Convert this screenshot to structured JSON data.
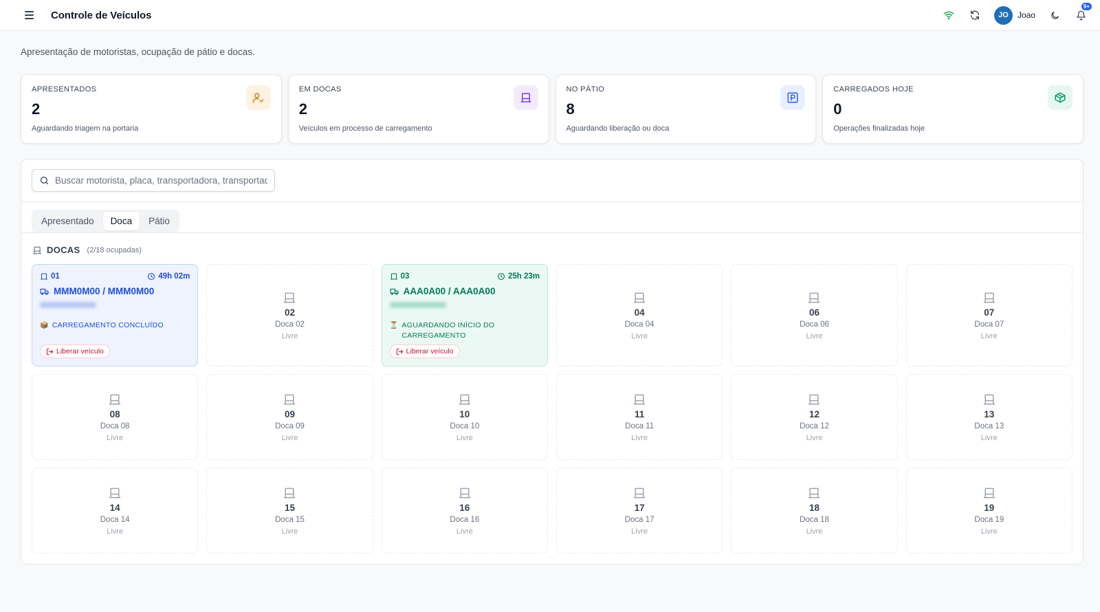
{
  "header": {
    "title": "Controle de Veículos",
    "user_initials": "JO",
    "user_name": "Joao",
    "notifications_badge": "9+"
  },
  "page": {
    "subtitle": "Apresentação de motoristas, ocupação de pátio e docas."
  },
  "stats": [
    {
      "label": "APRESENTADOS",
      "value": "2",
      "desc": "Aguardando triagem na portaria",
      "icon": "user-check-icon",
      "color": "#d97706"
    },
    {
      "label": "EM DOCAS",
      "value": "2",
      "desc": "Veículos em processo de carregamento",
      "icon": "dock-door-icon",
      "color": "#7c3aed"
    },
    {
      "label": "NO PÁTIO",
      "value": "8",
      "desc": "Aguardando liberação ou doca",
      "icon": "parking-icon",
      "color": "#2563eb"
    },
    {
      "label": "CARREGADOS HOJE",
      "value": "0",
      "desc": "Operações finalizadas hoje",
      "icon": "package-icon",
      "color": "#059669"
    }
  ],
  "search": {
    "placeholder": "Buscar motorista, placa, transportadora, transportadora..."
  },
  "tabs": [
    {
      "label": "Apresentado",
      "active": false
    },
    {
      "label": "Doca",
      "active": true
    },
    {
      "label": "Pátio",
      "active": false
    }
  ],
  "docas": {
    "title": "DOCAS",
    "count": "(2/18 ocupadas)",
    "occupied": [
      {
        "num": "01",
        "time": "49h 02m",
        "plates": "MMM0M00 / MMM0M00",
        "status": "CARREGAMENTO CONCLUÍDO",
        "status_icon": "box-icon",
        "release_label": "Liberar veículo",
        "theme": "blue"
      },
      {
        "num": "03",
        "time": "25h 23m",
        "plates": "AAA0A00 / AAA0A00",
        "status": "AGUARDANDO INÍCIO DO CARREGAMENTO",
        "status_icon": "hourglass-icon",
        "release_label": "Liberar veículo",
        "theme": "green"
      }
    ],
    "free": [
      {
        "num": "02",
        "name": "Doca 02",
        "status": "Livre"
      },
      {
        "num": "04",
        "name": "Doca 04",
        "status": "Livre"
      },
      {
        "num": "06",
        "name": "Doca 06",
        "status": "Livre"
      },
      {
        "num": "07",
        "name": "Doca 07",
        "status": "Livre"
      },
      {
        "num": "08",
        "name": "Doca 08",
        "status": "Livre"
      },
      {
        "num": "09",
        "name": "Doca 09",
        "status": "Livre"
      },
      {
        "num": "10",
        "name": "Doca 10",
        "status": "Livre"
      },
      {
        "num": "11",
        "name": "Doca 11",
        "status": "Livre"
      },
      {
        "num": "12",
        "name": "Doca 12",
        "status": "Livre"
      },
      {
        "num": "13",
        "name": "Doca 13",
        "status": "Livre"
      },
      {
        "num": "14",
        "name": "Doca 14",
        "status": "Livre"
      },
      {
        "num": "15",
        "name": "Doca 15",
        "status": "Livre"
      },
      {
        "num": "16",
        "name": "Doca 16",
        "status": "Livre"
      },
      {
        "num": "17",
        "name": "Doca 17",
        "status": "Livre"
      },
      {
        "num": "18",
        "name": "Doca 18",
        "status": "Livre"
      },
      {
        "num": "19",
        "name": "Doca 19",
        "status": "Livre"
      }
    ]
  }
}
